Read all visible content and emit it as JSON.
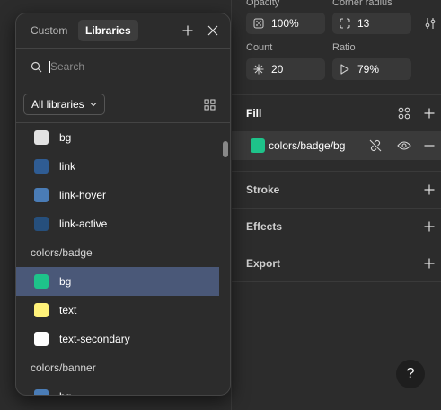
{
  "props": {
    "opacity_label": "Opacity",
    "opacity_value": "100%",
    "corner_radius_label": "Corner radius",
    "corner_radius_value": "13",
    "count_label": "Count",
    "count_value": "20",
    "ratio_label": "Ratio",
    "ratio_value": "79%"
  },
  "sections": {
    "fill": "Fill",
    "stroke": "Stroke",
    "effects": "Effects",
    "export": "Export"
  },
  "fill": {
    "style_name": "colors/badge/bg",
    "color": "#1ec38a"
  },
  "help_label": "?",
  "popover": {
    "tabs": [
      "Custom",
      "Libraries"
    ],
    "active_tab": "Libraries",
    "search_placeholder": "Search",
    "library_filter": "All libraries",
    "items": [
      {
        "kind": "color",
        "label": "bg",
        "color": "#e2e2e2"
      },
      {
        "kind": "color",
        "label": "link",
        "color": "#2f5c93"
      },
      {
        "kind": "color",
        "label": "link-hover",
        "color": "#4a7cb6"
      },
      {
        "kind": "color",
        "label": "link-active",
        "color": "#264f7c"
      },
      {
        "kind": "group",
        "label": "colors/badge"
      },
      {
        "kind": "color",
        "label": "bg",
        "color": "#1ec38a",
        "selected": true
      },
      {
        "kind": "color",
        "label": "text",
        "color": "#fff27a"
      },
      {
        "kind": "color",
        "label": "text-secondary",
        "color": "#ffffff"
      },
      {
        "kind": "group",
        "label": "colors/banner"
      },
      {
        "kind": "color",
        "label": "bg",
        "color": "#4a7cb6"
      }
    ]
  }
}
